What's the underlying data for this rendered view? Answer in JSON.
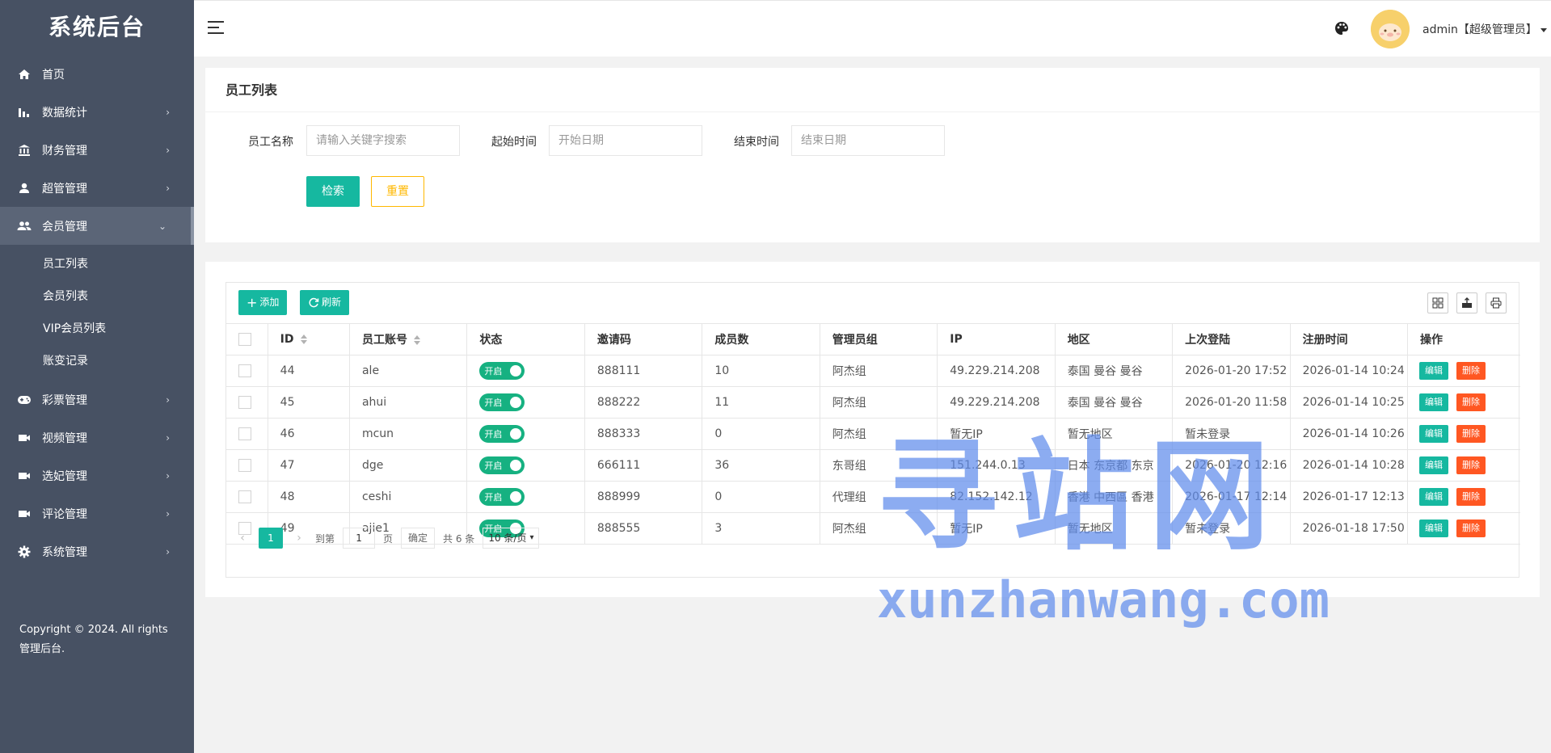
{
  "sidebar": {
    "logo": "系统后台",
    "menu": [
      {
        "label": "首页",
        "icon": "home-icon"
      },
      {
        "label": "数据统计",
        "icon": "bar-chart-icon"
      },
      {
        "label": "财务管理",
        "icon": "bank-icon"
      },
      {
        "label": "超管管理",
        "icon": "user-icon"
      },
      {
        "label": "会员管理",
        "icon": "users-icon"
      }
    ],
    "submenu": [
      "员工列表",
      "会员列表",
      "VIP会员列表",
      "账变记录"
    ],
    "menu2": [
      {
        "label": "彩票管理",
        "icon": "gamepad-icon"
      },
      {
        "label": "视频管理",
        "icon": "video-icon"
      },
      {
        "label": "选妃管理",
        "icon": "video-icon"
      },
      {
        "label": "评论管理",
        "icon": "video-icon"
      },
      {
        "label": "系统管理",
        "icon": "gear-icon"
      }
    ],
    "copyright": "Copyright © 2024. All rights 管理后台."
  },
  "header": {
    "user": "admin【超级管理员】"
  },
  "search": {
    "title": "员工列表",
    "name_label": "员工名称",
    "name_placeholder": "请输入关键字搜索",
    "start_label": "起始时间",
    "start_placeholder": "开始日期",
    "end_label": "结束时间",
    "end_placeholder": "结束日期",
    "search_btn": "检索",
    "reset_btn": "重置"
  },
  "toolbar": {
    "add": "添加",
    "refresh": "刷新"
  },
  "table": {
    "columns": [
      "ID",
      "员工账号",
      "状态",
      "邀请码",
      "成员数",
      "管理员组",
      "IP",
      "地区",
      "上次登陆",
      "注册时间",
      "操作"
    ],
    "rows": [
      {
        "id": "44",
        "account": "ale",
        "status": "开启",
        "code": "888111",
        "members": "10",
        "group": "阿杰组",
        "ip": "49.229.214.208",
        "region": "泰国 曼谷 曼谷",
        "last_login": "2026-01-20 17:52",
        "registered": "2026-01-14 10:24"
      },
      {
        "id": "45",
        "account": "ahui",
        "status": "开启",
        "code": "888222",
        "members": "11",
        "group": "阿杰组",
        "ip": "49.229.214.208",
        "region": "泰国 曼谷 曼谷",
        "last_login": "2026-01-20 11:58",
        "registered": "2026-01-14 10:25"
      },
      {
        "id": "46",
        "account": "mcun",
        "status": "开启",
        "code": "888333",
        "members": "0",
        "group": "阿杰组",
        "ip": "暂无IP",
        "region": "暂无地区",
        "last_login": "暂未登录",
        "registered": "2026-01-14 10:26"
      },
      {
        "id": "47",
        "account": "dge",
        "status": "开启",
        "code": "666111",
        "members": "36",
        "group": "东哥组",
        "ip": "151.244.0.13",
        "region": "日本 东京都 东京",
        "last_login": "2026-01-20 12:16",
        "registered": "2026-01-14 10:28"
      },
      {
        "id": "48",
        "account": "ceshi",
        "status": "开启",
        "code": "888999",
        "members": "0",
        "group": "代理组",
        "ip": "82.152.142.12",
        "region": "香港 中西區 香港",
        "last_login": "2026-01-17 12:14",
        "registered": "2026-01-17 12:13"
      },
      {
        "id": "49",
        "account": "ajie1",
        "status": "开启",
        "code": "888555",
        "members": "3",
        "group": "阿杰组",
        "ip": "暂无IP",
        "region": "暂无地区",
        "last_login": "暂未登录",
        "registered": "2026-01-18 17:50"
      }
    ],
    "edit": "编辑",
    "delete": "删除"
  },
  "pager": {
    "current": "1",
    "goto": "到第",
    "page_input": "1",
    "page_unit": "页",
    "confirm": "确定",
    "total": "共 6 条",
    "per_page": "10 条/页"
  },
  "watermark": {
    "big": "寻站网",
    "small": "xunzhanwang.com"
  },
  "colors": {
    "sidebar": "#475163",
    "primary": "#16b8a0",
    "warning": "#ffb800",
    "danger": "#ff5722"
  }
}
